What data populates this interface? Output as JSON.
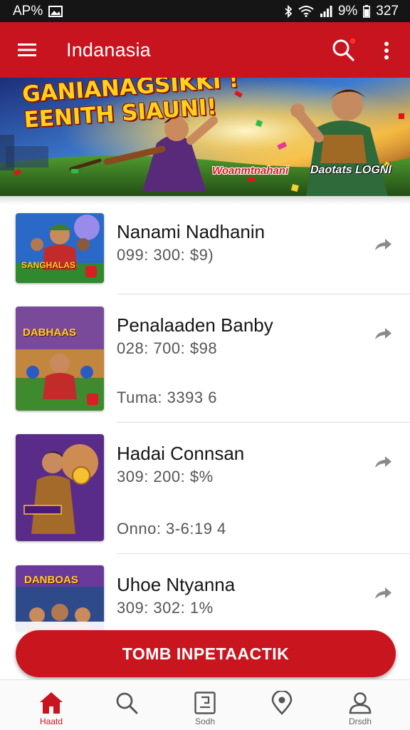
{
  "status_bar": {
    "left_text": "AP%",
    "battery": "9%",
    "time": "327"
  },
  "app_bar": {
    "title": "Indanasia"
  },
  "banner": {
    "headline": "GANIANAGSIKKI !\nEENITH SIAUNI!",
    "tag1": "Woanmtnahani",
    "tag2": "Daotats LOGNI"
  },
  "games": [
    {
      "title": "Nanami Nadhanin",
      "meta": "099: 300: $9)",
      "extra": ""
    },
    {
      "title": "Penalaaden Banby",
      "meta": "028: 700: $98",
      "extra": "Tuma: 3393 6"
    },
    {
      "title": "Hadai Connsan",
      "meta": "309: 200: $%",
      "extra": "Onno: 3-6:19 4"
    },
    {
      "title": "Uhoe Ntyanna",
      "meta": "309: 302: 1%",
      "extra": ""
    }
  ],
  "thumb_labels": [
    "SANGHALAS",
    "DABHAAS",
    "",
    "DANBOAS"
  ],
  "cta": {
    "label": "TOMB INPETAACTIK"
  },
  "nav": [
    {
      "label": "Haatd",
      "icon": "home-icon",
      "active": true
    },
    {
      "label": "",
      "icon": "search-icon",
      "active": false
    },
    {
      "label": "Sodh",
      "icon": "doc-icon",
      "active": false
    },
    {
      "label": "",
      "icon": "location-icon",
      "active": false
    },
    {
      "label": "Drsdh",
      "icon": "profile-icon",
      "active": false
    }
  ],
  "colors": {
    "brand_red": "#c8141e",
    "status_bar": "#151515",
    "text_dark": "#151515",
    "text_muted": "#555555"
  }
}
